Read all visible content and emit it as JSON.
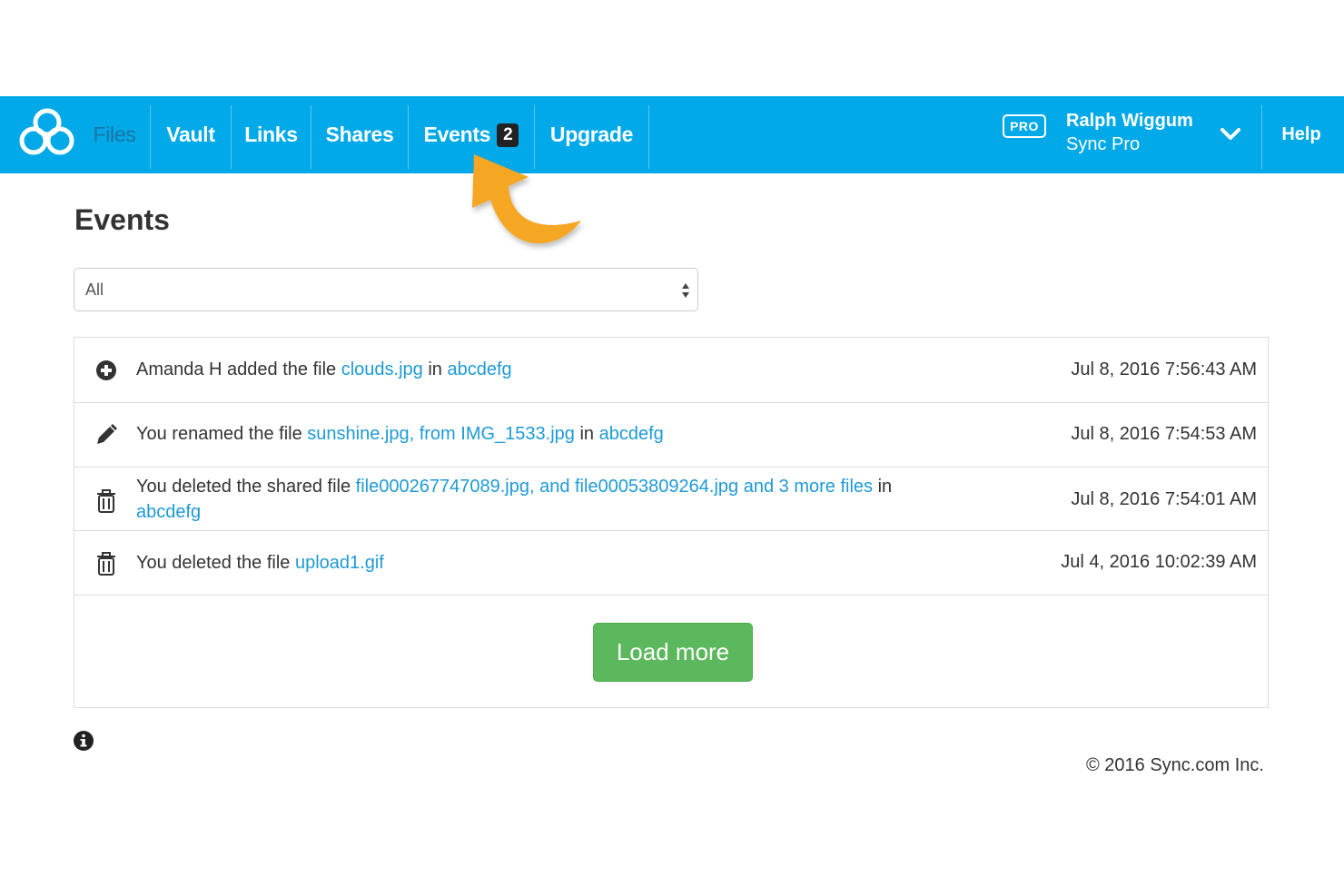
{
  "nav": {
    "items": [
      {
        "label": "Files"
      },
      {
        "label": "Vault"
      },
      {
        "label": "Links"
      },
      {
        "label": "Shares"
      },
      {
        "label": "Events",
        "badge": "2"
      },
      {
        "label": "Upgrade"
      }
    ],
    "pro_badge": "PRO",
    "user_name": "Ralph Wiggum",
    "user_plan": "Sync Pro",
    "help": "Help"
  },
  "page": {
    "title": "Events",
    "filter_value": "All"
  },
  "events": [
    {
      "icon": "plus-circle-icon",
      "parts": [
        "Amanda H added the file ",
        "clouds.jpg",
        " in ",
        "abcdefg"
      ],
      "date": "Jul 8, 2016 7:56:43 AM"
    },
    {
      "icon": "pencil-icon",
      "parts": [
        "You renamed the file ",
        "sunshine.jpg, from IMG_1533.jpg",
        " in ",
        "abcdefg"
      ],
      "date": "Jul 8, 2016 7:54:53 AM"
    },
    {
      "icon": "trash-icon",
      "parts": [
        "You deleted the shared file ",
        "file000267747089.jpg, and file00053809264.jpg and 3 more files",
        " in ",
        "abcdefg"
      ],
      "date": "Jul 8, 2016 7:54:01 AM"
    },
    {
      "icon": "trash-icon",
      "parts": [
        "You deleted the file ",
        "upload1.gif"
      ],
      "date": "Jul 4, 2016 10:02:39 AM"
    }
  ],
  "load_more": "Load more",
  "footer": {
    "copyright": "© 2016 Sync.com Inc."
  },
  "colors": {
    "navbar": "#02a9e9",
    "link": "#1e9ad6",
    "button": "#5cb85c",
    "arrow": "#f5a623"
  }
}
